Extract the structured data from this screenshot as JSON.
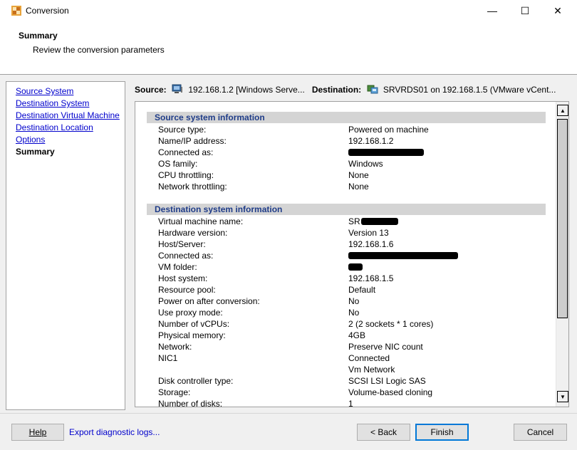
{
  "window": {
    "title": "Conversion",
    "controls": {
      "minimize": "—",
      "maximize": "☐",
      "close": "✕"
    }
  },
  "header": {
    "title": "Summary",
    "subtitle": "Review the conversion parameters"
  },
  "nav": {
    "items": [
      {
        "label": "Source System",
        "current": false
      },
      {
        "label": "Destination System",
        "current": false
      },
      {
        "label": "Destination Virtual Machine",
        "current": false
      },
      {
        "label": "Destination Location",
        "current": false
      },
      {
        "label": "Options",
        "current": false
      },
      {
        "label": "Summary",
        "current": true
      }
    ]
  },
  "summary_bar": {
    "source_label": "Source:",
    "source_value": "192.168.1.2 [Windows Serve...",
    "destination_label": "Destination:",
    "destination_value": "SRVRDS01 on 192.168.1.5 (VMware vCent..."
  },
  "source_section": {
    "title": "Source system information",
    "rows": [
      {
        "label": "Source type:",
        "value": "Powered on machine"
      },
      {
        "label": "Name/IP address:",
        "value": "192.168.1.2"
      },
      {
        "label": "Connected as:",
        "value": ""
      },
      {
        "label": "OS family:",
        "value": "Windows"
      },
      {
        "label": "CPU throttling:",
        "value": "None"
      },
      {
        "label": "Network throttling:",
        "value": "None"
      }
    ]
  },
  "destination_section": {
    "title": "Destination system information",
    "rows": [
      {
        "label": "Virtual machine name:",
        "value": "SR"
      },
      {
        "label": "Hardware version:",
        "value": "Version 13"
      },
      {
        "label": "Host/Server:",
        "value": "192.168.1.6"
      },
      {
        "label": "Connected as:",
        "value": ""
      },
      {
        "label": "VM folder:",
        "value": ""
      },
      {
        "label": "Host system:",
        "value": "192.168.1.5"
      },
      {
        "label": "Resource pool:",
        "value": "Default"
      },
      {
        "label": "Power on after conversion:",
        "value": "No"
      },
      {
        "label": "Use proxy mode:",
        "value": "No"
      },
      {
        "label": "Number of vCPUs:",
        "value": "2 (2 sockets * 1 cores)"
      },
      {
        "label": "Physical memory:",
        "value": "4GB"
      },
      {
        "label": "Network:",
        "value": "Preserve NIC count"
      },
      {
        "label": "NIC1",
        "value": "Connected"
      },
      {
        "label": "",
        "value": "Vm Network"
      },
      {
        "label": "Disk controller type:",
        "value": "SCSI LSI Logic SAS"
      },
      {
        "label": "Storage:",
        "value": "Volume-based cloning"
      },
      {
        "label": "Number of disks:",
        "value": "1"
      }
    ]
  },
  "footer": {
    "help_label": "Help",
    "export_link": "Export diagnostic logs...",
    "back_label": "< Back",
    "finish_label": "Finish",
    "cancel_label": "Cancel"
  },
  "colors": {
    "link": "#0000cc",
    "section_header_text": "#1f3c88",
    "section_header_bg": "#d4d4d4",
    "default_button_border": "#0078d7"
  },
  "icons": {
    "app": "conversion-app-icon",
    "source": "computer-monitor-icon",
    "destination": "vm-host-icon"
  },
  "scroll_position": 0
}
